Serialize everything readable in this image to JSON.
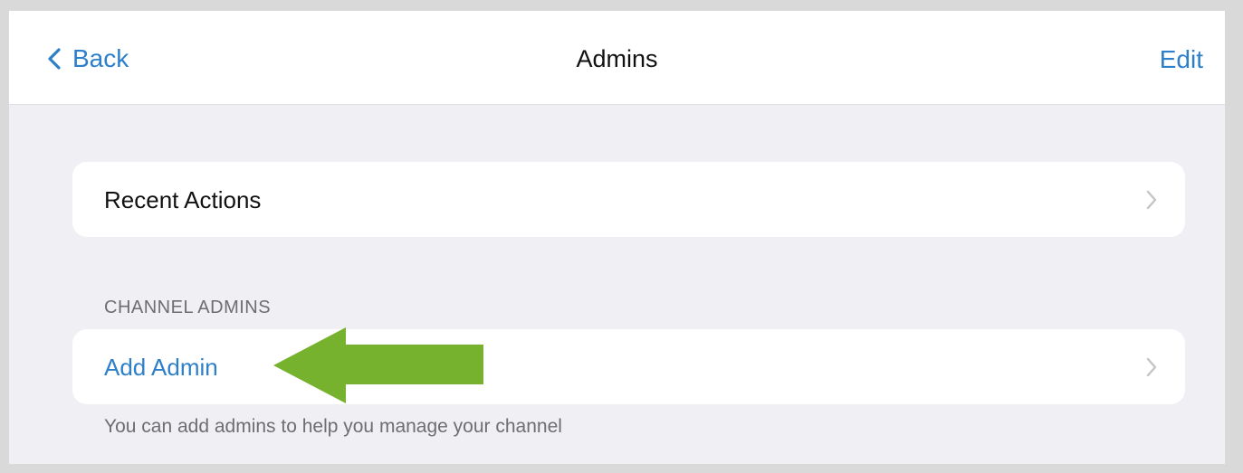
{
  "navbar": {
    "back_label": "Back",
    "title": "Admins",
    "edit_label": "Edit"
  },
  "recent_actions": {
    "label": "Recent Actions"
  },
  "channel_admins": {
    "section_header": "CHANNEL ADMINS",
    "add_admin_label": "Add Admin",
    "footer_note": "You can add admins to help you manage your channel"
  },
  "icons": {
    "back": "chevron-left-icon",
    "disclosure": "chevron-right-icon",
    "annotation": "green-arrow"
  },
  "colors": {
    "accent": "#2e7fc9",
    "background": "#efeff4",
    "annotation": "#77b22f"
  }
}
